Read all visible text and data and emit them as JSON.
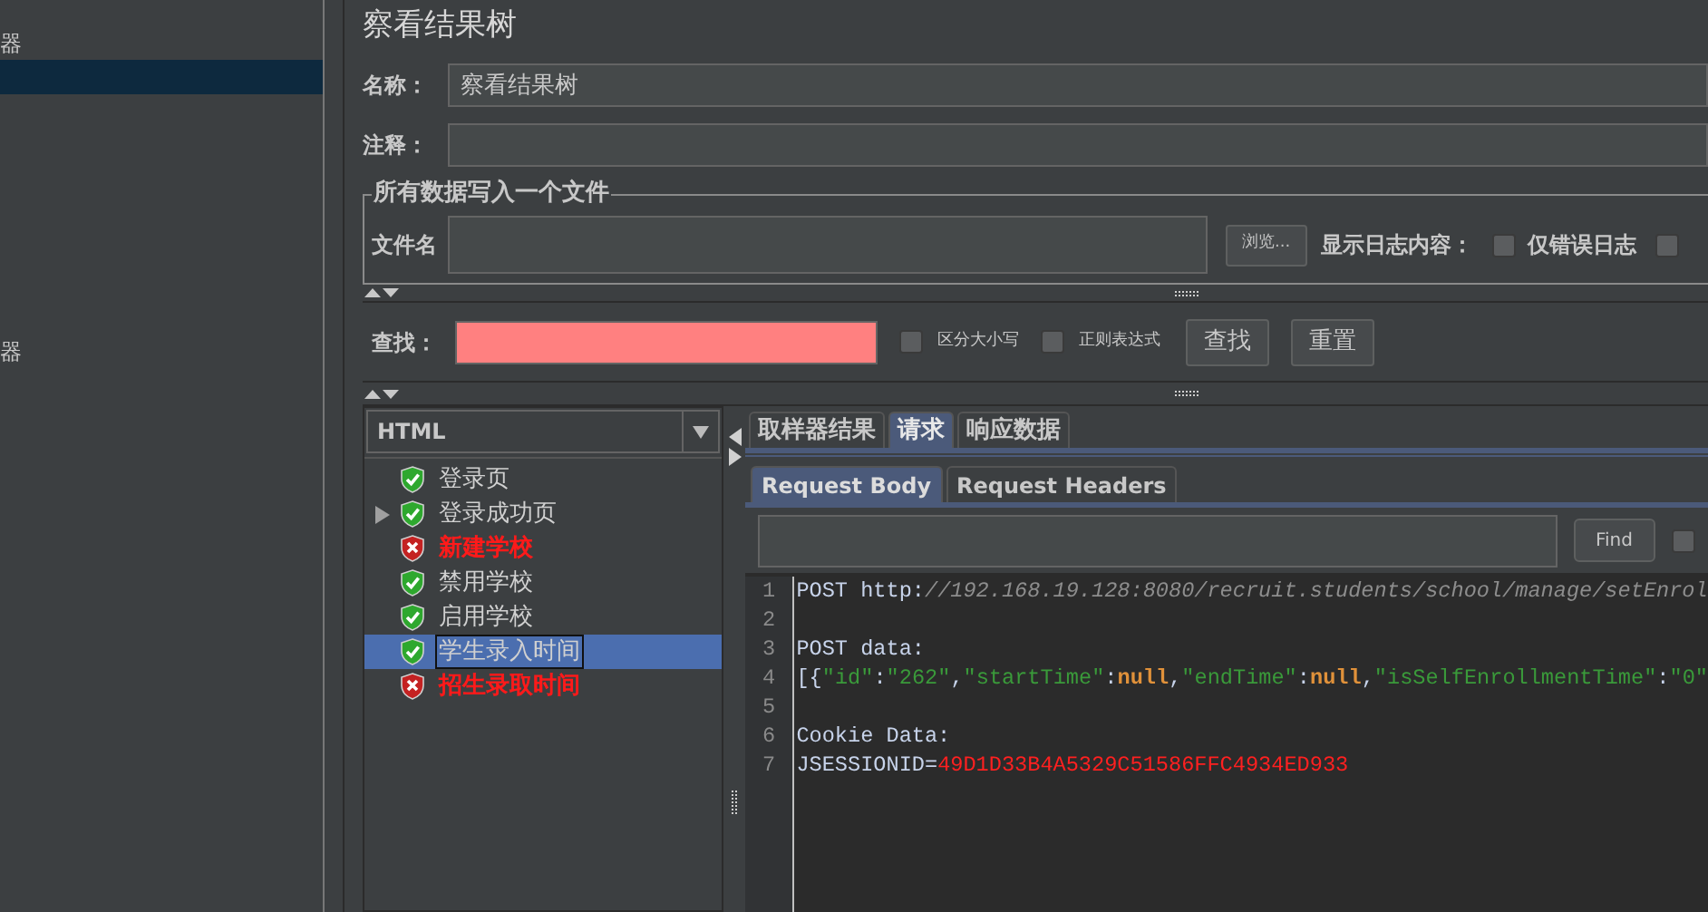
{
  "sidebar": {
    "items": [
      {
        "label": "器",
        "selected": false
      },
      {
        "selected": true
      },
      {
        "label": "器",
        "selected": false
      }
    ]
  },
  "title": "察看结果树",
  "name_field": {
    "label": "名称：",
    "value": "察看结果树"
  },
  "comment_field": {
    "label": "注释："
  },
  "file_group": {
    "legend": "所有数据写入一个文件",
    "file_label": "文件名",
    "browse_button": "浏览...",
    "log_label": "显示日志内容：",
    "checkboxes": [
      {
        "label": "仅错误日志",
        "checked": false
      },
      {
        "checked": false
      }
    ]
  },
  "search": {
    "label": "查找：",
    "invalid": true,
    "options": [
      {
        "label": "区分大小写",
        "checked": false
      },
      {
        "label": "正则表达式",
        "checked": false
      }
    ],
    "buttons": [
      "查找",
      "重置"
    ]
  },
  "renderer": {
    "value": "HTML"
  },
  "tree": {
    "items": [
      {
        "label": "登录页",
        "failed": false,
        "selected": false
      },
      {
        "label": "登录成功页",
        "failed": false,
        "expanded": false,
        "selected": false
      },
      {
        "label": "新建学校",
        "failed": true,
        "selected": false
      },
      {
        "label": "禁用学校",
        "failed": false,
        "selected": false
      },
      {
        "label": "启用学校",
        "failed": false,
        "selected": false
      },
      {
        "label": "学生录入时间",
        "failed": false,
        "selected": true
      },
      {
        "label": "招生录取时间",
        "failed": true,
        "selected": false
      }
    ]
  },
  "tabs": [
    {
      "label": "取样器结果",
      "selected": false
    },
    {
      "label": "请求",
      "selected": true
    },
    {
      "label": "响应数据",
      "selected": false
    }
  ],
  "sub_tabs": [
    {
      "label": "Request Body",
      "selected": true
    },
    {
      "label": "Request Headers",
      "selected": false
    }
  ],
  "find": {
    "button": "Find",
    "checked": false
  },
  "code": {
    "lines": [
      {
        "number": "1",
        "segments": [
          {
            "kind": "plain",
            "text": "POST http:"
          },
          {
            "kind": "url",
            "text": "//192.168.19.128:8080/recruit.students/school/manage/setEnrol"
          }
        ]
      },
      {
        "number": "2"
      },
      {
        "number": "3",
        "segments": [
          {
            "kind": "plain",
            "text": "POST data:"
          }
        ]
      },
      {
        "number": "4",
        "segments": [
          {
            "kind": "plain",
            "text": "[{"
          },
          {
            "kind": "string",
            "text": "\"id\""
          },
          {
            "kind": "plain",
            "text": ":"
          },
          {
            "kind": "string",
            "text": "\"262\""
          },
          {
            "kind": "plain",
            "text": ","
          },
          {
            "kind": "string",
            "text": "\"startTime\""
          },
          {
            "kind": "plain",
            "text": ":"
          },
          {
            "kind": "keyword",
            "text": "null"
          },
          {
            "kind": "plain",
            "text": ","
          },
          {
            "kind": "string",
            "text": "\"endTime\""
          },
          {
            "kind": "plain",
            "text": ":"
          },
          {
            "kind": "keyword",
            "text": "null"
          },
          {
            "kind": "plain",
            "text": ","
          },
          {
            "kind": "string",
            "text": "\"isSelfEnrollmentTime\""
          },
          {
            "kind": "plain",
            "text": ":"
          },
          {
            "kind": "string",
            "text": "\"0\""
          }
        ]
      },
      {
        "number": "5"
      },
      {
        "number": "6",
        "segments": [
          {
            "kind": "plain",
            "text": "Cookie Data:"
          }
        ]
      },
      {
        "number": "7",
        "segments": [
          {
            "kind": "plain",
            "text": "JSESSIONID="
          },
          {
            "kind": "value",
            "text": "49D1D33B4A5329C51586FFC4934ED933"
          }
        ]
      }
    ]
  }
}
